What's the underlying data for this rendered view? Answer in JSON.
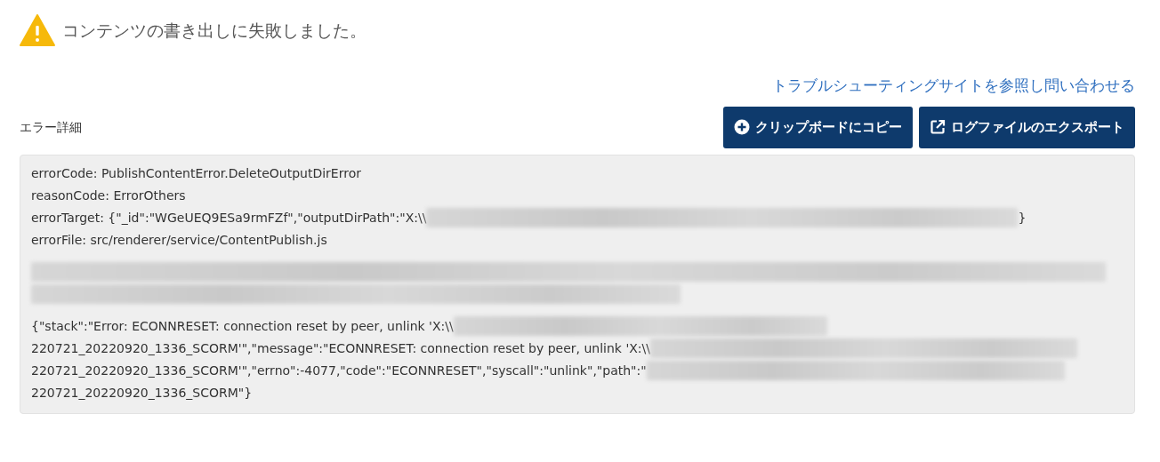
{
  "alert": {
    "message": "コンテンツの書き出しに失敗しました。"
  },
  "help_link": "トラブルシューティングサイトを参照し問い合わせる",
  "details_label": "エラー詳細",
  "buttons": [
    {
      "kind": "copy",
      "label": "クリップボードにコピー"
    },
    {
      "kind": "export",
      "label": "ログファイルのエクスポート"
    }
  ],
  "details": [
    {
      "lines": [
        [
          {
            "kind": "text",
            "text": "errorCode: PublishContentError.DeleteOutputDirError"
          }
        ],
        [
          {
            "kind": "text",
            "text": "reasonCode: ErrorOthers"
          }
        ],
        [
          {
            "kind": "text",
            "text": "errorTarget: {\"_id\":\"WGeUEQ9ESa9rmFZf\",\"outputDirPath\":\"X:\\\\"
          },
          {
            "kind": "redacted"
          },
          {
            "kind": "text",
            "text": "}"
          }
        ],
        [
          {
            "kind": "text",
            "text": "errorFile: src/renderer/service/ContentPublish.js"
          }
        ]
      ]
    },
    {
      "lines": [
        [
          {
            "kind": "redacted"
          }
        ],
        [
          {
            "kind": "redacted"
          }
        ]
      ]
    },
    {
      "lines": [
        [
          {
            "kind": "text",
            "text": "{\"stack\":\"Error: ECONNRESET: connection reset by peer, unlink 'X:\\\\"
          },
          {
            "kind": "redacted"
          }
        ],
        [
          {
            "kind": "text",
            "text": "220721_20220920_1336_SCORM'\",\"message\":\"ECONNRESET: connection reset by peer, unlink 'X:\\\\"
          },
          {
            "kind": "redacted"
          }
        ],
        [
          {
            "kind": "text",
            "text": "220721_20220920_1336_SCORM'\",\"errno\":-4077,\"code\":\"ECONNRESET\",\"syscall\":\"unlink\",\"path\":\""
          },
          {
            "kind": "redacted"
          }
        ],
        [
          {
            "kind": "text",
            "text": "220721_20220920_1336_SCORM\"}"
          }
        ]
      ]
    }
  ]
}
